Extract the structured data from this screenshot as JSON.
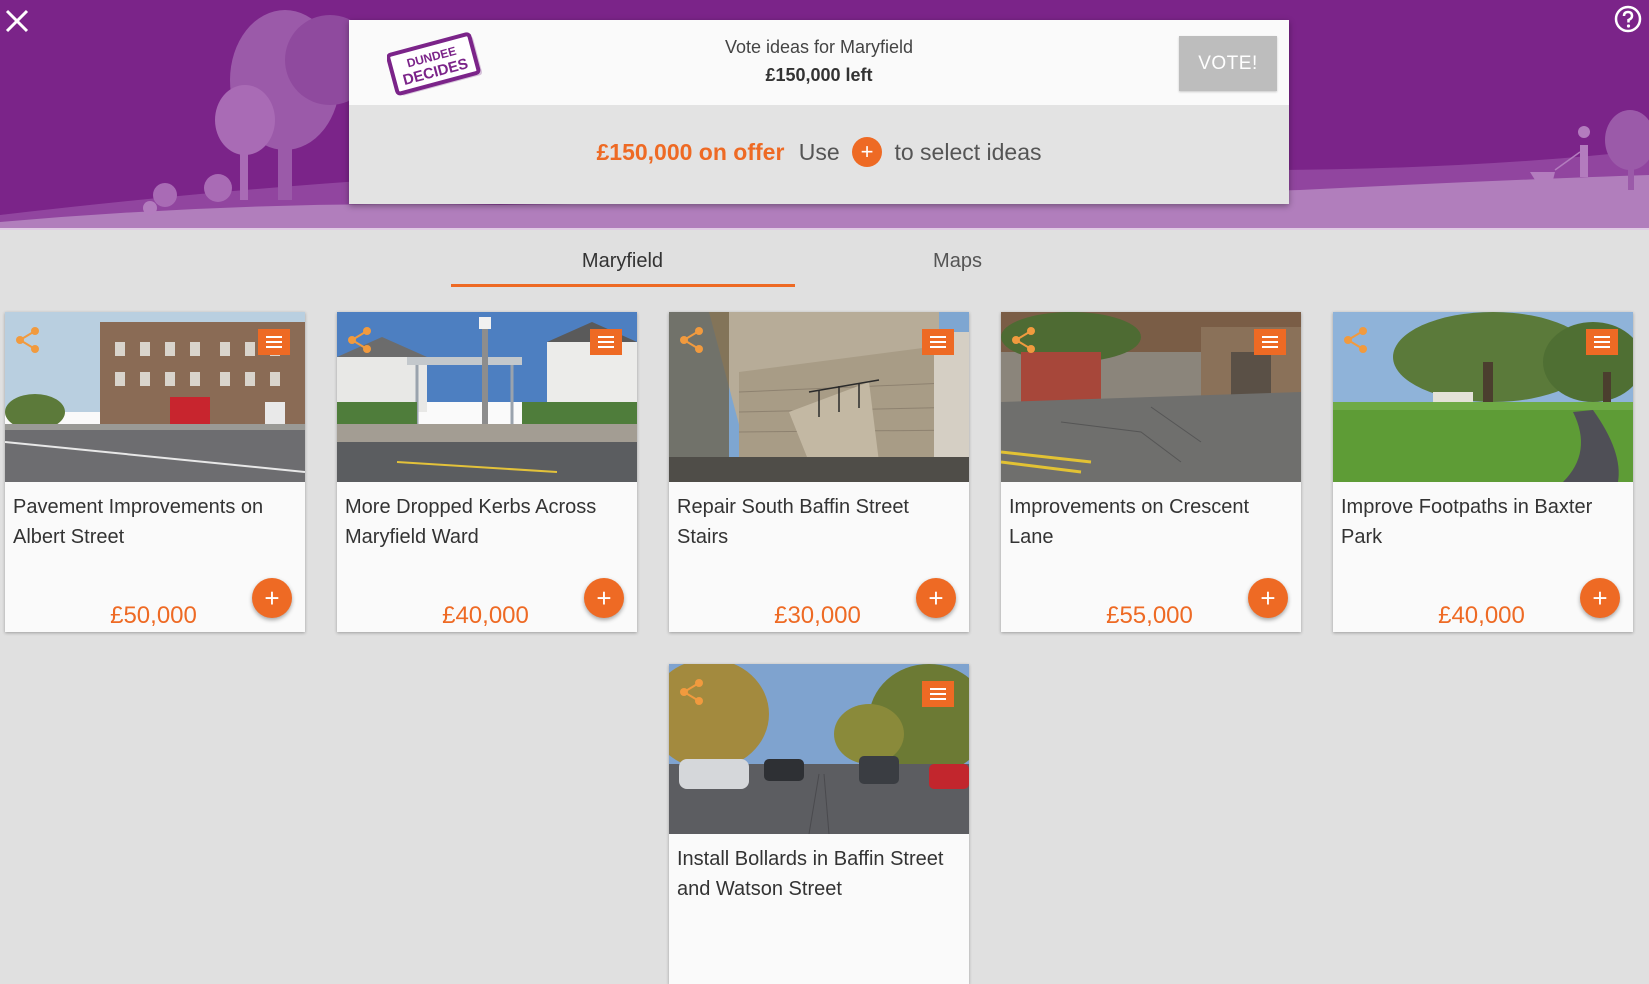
{
  "header": {
    "close_icon": "close-icon",
    "help_icon": "help-icon"
  },
  "panel": {
    "logo_line1": "DUNDEE",
    "logo_line2": "DECIDES",
    "title": "Vote ideas for Maryfield",
    "budget_left": "£150,000 left",
    "vote_label": "VOTE!",
    "offer_amount": "£150,000 on offer",
    "offer_use": "Use",
    "offer_plus": "+",
    "offer_rest": "to select ideas"
  },
  "tabs": [
    {
      "label": "Maryfield",
      "active": true
    },
    {
      "label": "Maps",
      "active": false
    }
  ],
  "ideas": [
    {
      "title": "Pavement Improvements on Albert Street",
      "price": "£50,000"
    },
    {
      "title": "More Dropped Kerbs Across Maryfield Ward",
      "price": "£40,000"
    },
    {
      "title": "Repair South Baffin Street Stairs",
      "price": "£30,000"
    },
    {
      "title": "Improvements on Crescent Lane",
      "price": "£55,000"
    },
    {
      "title": "Improve Footpaths in Baxter Park",
      "price": "£40,000"
    },
    {
      "title": "Install Bollards in Baffin Street and Watson Street",
      "price": ""
    }
  ],
  "add_label": "+",
  "colors": {
    "header_purple": "#7b2489",
    "accent_orange": "#ee6a24",
    "background": "#e0e0e0"
  }
}
